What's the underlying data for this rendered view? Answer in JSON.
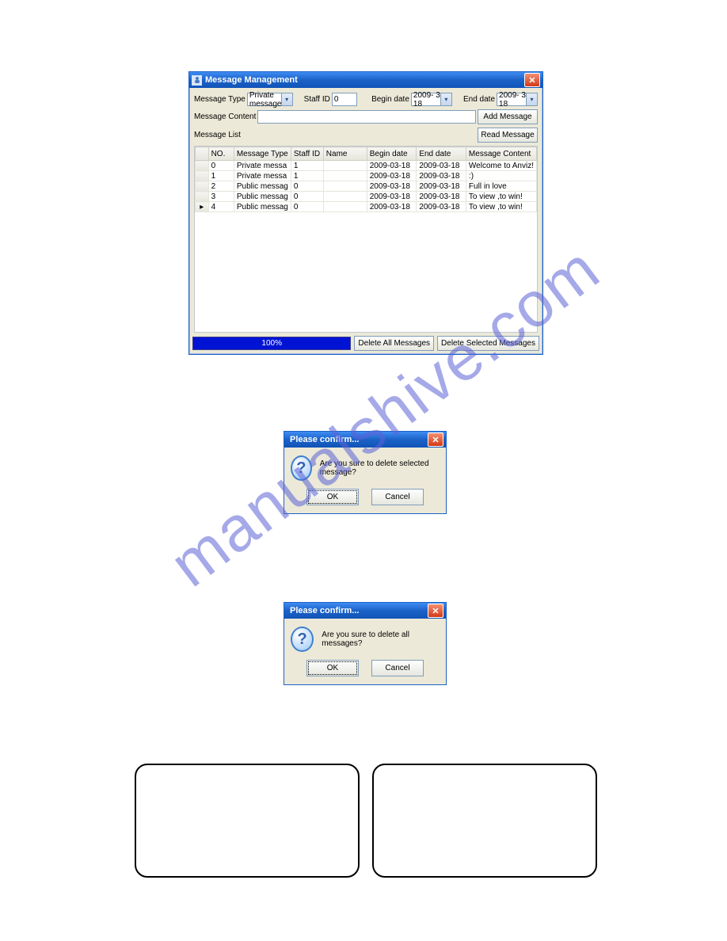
{
  "watermark": "manualshive.com",
  "main": {
    "title": "Message Management",
    "labels": {
      "messageType": "Message Type",
      "staffId": "Staff ID",
      "beginDate": "Begin date",
      "endDate": "End date",
      "messageContent": "Message Content",
      "messageList": "Message List"
    },
    "form": {
      "messageTypeValue": "Private message",
      "staffIdValue": "0",
      "beginDateValue": "2009- 3-18",
      "endDateValue": "2009- 3-18",
      "messageContentValue": ""
    },
    "buttons": {
      "addMessage": "Add Message",
      "readMessage": "Read Message",
      "deleteAll": "Delete All Messages",
      "deleteSelected": "Delete Selected Messages"
    },
    "columns": [
      "NO.",
      "Message Type",
      "Staff ID",
      "Name",
      "Begin date",
      "End date",
      "Message Content"
    ],
    "rows": [
      {
        "marker": "",
        "no": "0",
        "type": "Private messa",
        "staff": "1",
        "name": "",
        "begin": "2009-03-18",
        "end": "2009-03-18",
        "content": "Welcome to Anviz!"
      },
      {
        "marker": "",
        "no": "1",
        "type": "Private messa",
        "staff": "1",
        "name": "",
        "begin": "2009-03-18",
        "end": "2009-03-18",
        "content": ":)"
      },
      {
        "marker": "",
        "no": "2",
        "type": "Public messag",
        "staff": "0",
        "name": "",
        "begin": "2009-03-18",
        "end": "2009-03-18",
        "content": "Full in love"
      },
      {
        "marker": "",
        "no": "3",
        "type": "Public messag",
        "staff": "0",
        "name": "",
        "begin": "2009-03-18",
        "end": "2009-03-18",
        "content": "To view ,to win!"
      },
      {
        "marker": "▸",
        "no": "4",
        "type": "Public messag",
        "staff": "0",
        "name": "",
        "begin": "2009-03-18",
        "end": "2009-03-18",
        "content": "To view ,to win!"
      }
    ],
    "progress": "100%"
  },
  "confirm1": {
    "title": "Please confirm...",
    "message": "Are you sure to delete selected message?",
    "ok": "OK",
    "cancel": "Cancel"
  },
  "confirm2": {
    "title": "Please confirm...",
    "message": "Are you sure to delete all messages?",
    "ok": "OK",
    "cancel": "Cancel"
  }
}
